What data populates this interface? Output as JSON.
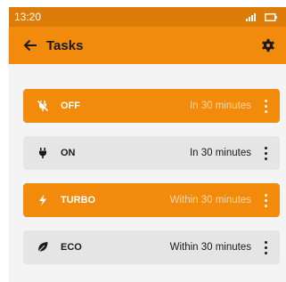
{
  "status_bar": {
    "time": "13:20",
    "signal_icon": "signal-icon",
    "battery_icon": "battery-icon"
  },
  "app_bar": {
    "title": "Tasks",
    "back_icon": "back-arrow-icon",
    "settings_icon": "gear-icon"
  },
  "tasks": [
    {
      "name": "OFF",
      "time": "In 30 minutes",
      "icon": "plug-off-icon",
      "active": true
    },
    {
      "name": "ON",
      "time": "In 30 minutes",
      "icon": "plug-icon",
      "active": false
    },
    {
      "name": "TURBO",
      "time": "Within 30 minutes",
      "icon": "lightning-icon",
      "active": true
    },
    {
      "name": "ECO",
      "time": "Within 30 minutes",
      "icon": "leaf-icon",
      "active": false
    }
  ],
  "colors": {
    "accent": "#f28a0c",
    "status_bar": "#dd7c09",
    "inactive_row": "#e5e5e5"
  }
}
